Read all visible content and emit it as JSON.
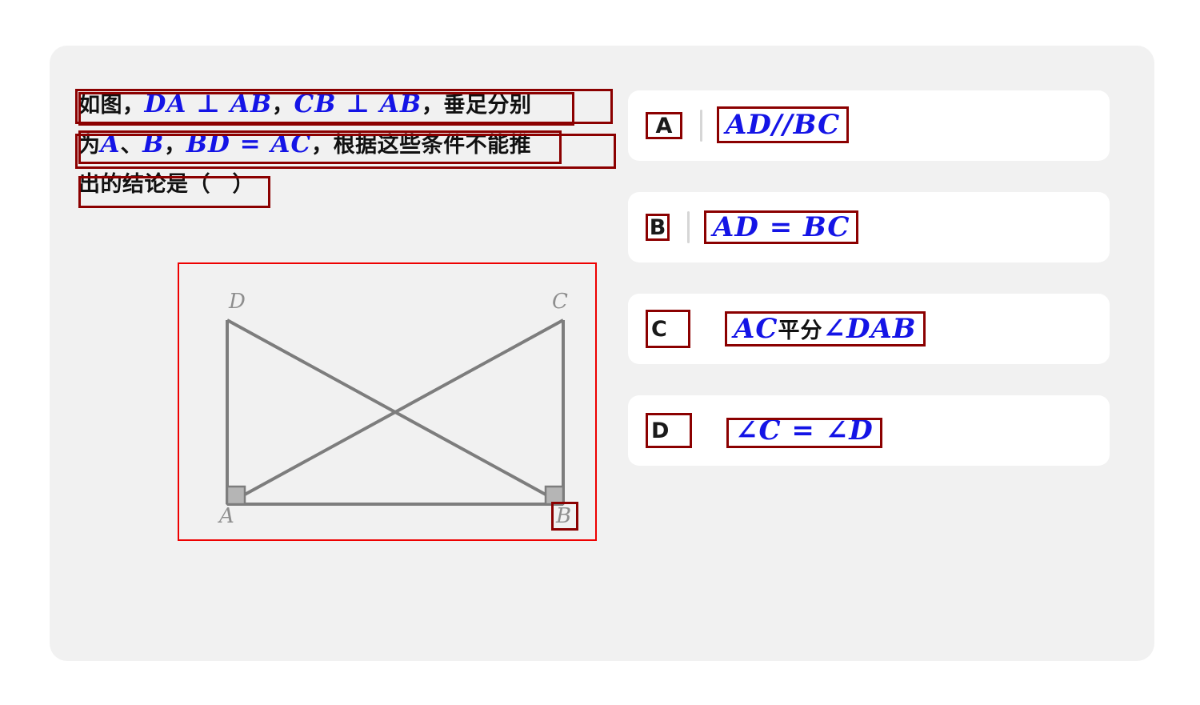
{
  "question": {
    "lines": [
      {
        "id": "line1",
        "segments": [
          {
            "type": "zh",
            "text": "如图，"
          },
          {
            "type": "math",
            "text": "DA ⊥ AB"
          },
          {
            "type": "zh",
            "text": "，"
          },
          {
            "type": "math",
            "text": "CB ⊥ AB"
          },
          {
            "type": "zh",
            "text": "，垂足分别"
          }
        ]
      },
      {
        "id": "line2",
        "segments": [
          {
            "type": "zh",
            "text": "为"
          },
          {
            "type": "math",
            "text": "A"
          },
          {
            "type": "zh",
            "text": "、"
          },
          {
            "type": "math",
            "text": "B"
          },
          {
            "type": "zh",
            "text": "，"
          },
          {
            "type": "math",
            "text": "BD = AC"
          },
          {
            "type": "zh",
            "text": "，根据这些条件不能推"
          }
        ]
      },
      {
        "id": "line3",
        "segments": [
          {
            "type": "zh",
            "text": "出的结论是（　）"
          }
        ]
      }
    ],
    "line1_text_a": "如图，",
    "line1_math_1": "DA ⊥ AB",
    "line1_comma_1": "，",
    "line1_math_2": "CB ⊥ AB",
    "line1_tail": "，垂足分别",
    "line2_text_a": "为",
    "line2_math_1": "A",
    "line2_sep": "、",
    "line2_math_2": "B",
    "line2_comma": "，",
    "line2_math_3": "BD = AC",
    "line2_tail": "，根据这些条件不能推",
    "line3_text": "出的结论是（　）"
  },
  "figure": {
    "labels": {
      "D": "D",
      "C": "C",
      "A": "A",
      "B": "B"
    },
    "stroke_color": "#7d7d7d",
    "right_angle_fill": "#b5b5b5",
    "border_color": "#ee0000"
  },
  "options": [
    {
      "letter": "A",
      "formula_parts": [
        {
          "type": "math",
          "text": "AD//BC"
        }
      ],
      "formula_plain": "AD//BC",
      "has_divider": true
    },
    {
      "letter": "B",
      "formula_parts": [
        {
          "type": "math",
          "text": "AD = BC"
        }
      ],
      "formula_plain": "AD = BC",
      "has_divider": true
    },
    {
      "letter": "C",
      "formula_parts": [
        {
          "type": "math",
          "text": "AC"
        },
        {
          "type": "zh",
          "text": "平分"
        },
        {
          "type": "math",
          "text": "∠DAB"
        }
      ],
      "formula_plain": "AC平分∠DAB",
      "has_divider": false
    },
    {
      "letter": "D",
      "formula_parts": [
        {
          "type": "math",
          "text": "∠C = ∠D"
        }
      ],
      "formula_plain": "∠C = ∠D",
      "has_divider": false
    }
  ],
  "colors": {
    "page_background": "#ffffff",
    "panel_background": "#f1f1f1",
    "card_background": "#ffffff",
    "annotation_red": "#8B0000",
    "figure_border_red": "#ee0000",
    "math_blue": "#1414e6",
    "text_black": "#111111",
    "divider_gray": "#d6d6d6"
  }
}
